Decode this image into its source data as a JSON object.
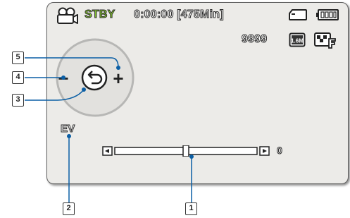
{
  "status": {
    "mode": "STBY",
    "timecode": "0:00:00",
    "remaining": "[475Min]",
    "shots_remaining": "9999"
  },
  "icons": {
    "camera": "camcorder-icon",
    "card": "memory-card-icon",
    "battery": "battery-full-icon",
    "resolution": "1.6M",
    "quality": "quality-fine-icon"
  },
  "dial": {
    "minus_label": "−",
    "plus_label": "+",
    "center_icon": "return-icon"
  },
  "ev": {
    "label": "EV",
    "value": "0",
    "slider_level": 0.5,
    "left_arrow": "left-arrow-icon",
    "right_arrow": "right-arrow-icon"
  },
  "callouts": [
    "1",
    "2",
    "3",
    "4",
    "5"
  ],
  "colors": {
    "mode_text": "#8ad12c",
    "screen_bg": "#ecebe8",
    "leader_line": "#0b5fa5"
  }
}
